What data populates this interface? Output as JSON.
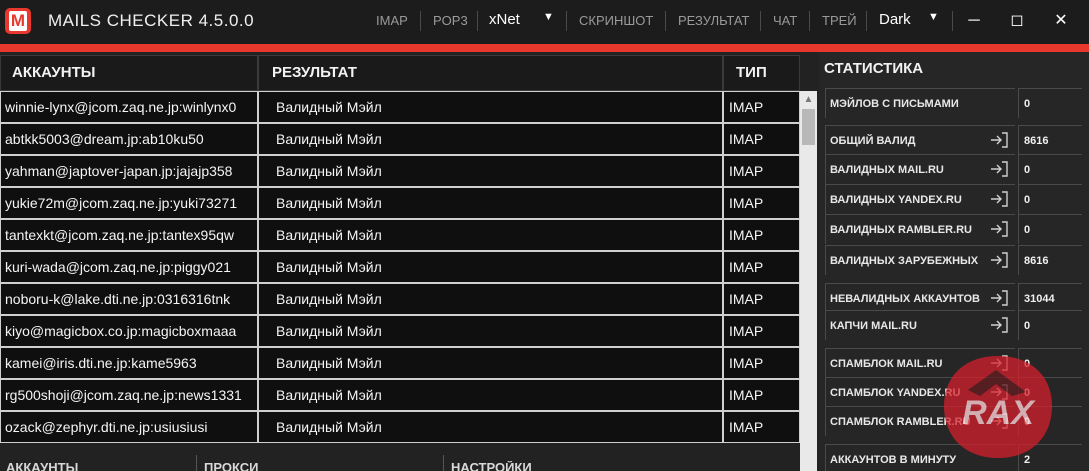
{
  "window": {
    "title": "MAILS CHECKER 4.5.0.0",
    "logo_letter": "M"
  },
  "menu": {
    "imap": "IMAP",
    "pop3": "POP3",
    "proxy_type": "xNet",
    "screenshot": "СКРИНШОТ",
    "result": "РЕЗУЛЬТАТ",
    "chat": "ЧАТ",
    "tray": "ТРЕЙ",
    "theme": "Dark"
  },
  "table": {
    "headers": {
      "accounts": "АККАУНТЫ",
      "result": "РЕЗУЛЬТАТ",
      "type": "ТИП"
    },
    "rows": [
      {
        "account": "winnie-lynx@jcom.zaq.ne.jp:winlynx0",
        "result": "Валидный Мэйл",
        "type": "IMAP"
      },
      {
        "account": "abtkk5003@dream.jp:ab10ku50",
        "result": "Валидный Мэйл",
        "type": "IMAP"
      },
      {
        "account": "yahman@japtover-japan.jp:jajajp358",
        "result": "Валидный Мэйл",
        "type": "IMAP"
      },
      {
        "account": "yukie72m@jcom.zaq.ne.jp:yuki73271",
        "result": "Валидный Мэйл",
        "type": "IMAP"
      },
      {
        "account": "tantexkt@jcom.zaq.ne.jp:tantex95qw",
        "result": "Валидный Мэйл",
        "type": "IMAP"
      },
      {
        "account": "kuri-wada@jcom.zaq.ne.jp:piggy021",
        "result": "Валидный Мэйл",
        "type": "IMAP"
      },
      {
        "account": "noboru-k@lake.dti.ne.jp:0316316tnk",
        "result": "Валидный Мэйл",
        "type": "IMAP"
      },
      {
        "account": "kiyo@magicbox.co.jp:magicboxmaaa",
        "result": "Валидный Мэйл",
        "type": "IMAP"
      },
      {
        "account": "kamei@iris.dti.ne.jp:kame5963",
        "result": "Валидный Мэйл",
        "type": "IMAP"
      },
      {
        "account": "rg500shoji@jcom.zaq.ne.jp:news1331",
        "result": "Валидный Мэйл",
        "type": "IMAP"
      },
      {
        "account": "ozack@zephyr.dti.ne.jp:usiusiusi",
        "result": "Валидный Мэйл",
        "type": "IMAP"
      }
    ]
  },
  "bottom_tabs": {
    "accounts": "АККАУНТЫ",
    "proxy": "ПРОКСИ",
    "settings": "НАСТРОЙКИ"
  },
  "stats": {
    "title": "СТАТИСТИКА",
    "rows": [
      {
        "label": "МЭЙЛОВ С ПИСЬМАМИ",
        "value": "0",
        "export": false
      },
      {
        "label": "ОБЩИЙ ВАЛИД",
        "value": "8616",
        "export": true
      },
      {
        "label": "ВАЛИДНЫХ MAIL.RU",
        "value": "0",
        "export": true
      },
      {
        "label": "ВАЛИДНЫХ YANDEX.RU",
        "value": "0",
        "export": true
      },
      {
        "label": "ВАЛИДНЫХ RAMBLER.RU",
        "value": "0",
        "export": true
      },
      {
        "label": "ВАЛИДНЫХ ЗАРУБЕЖНЫХ",
        "value": "8616",
        "export": true
      },
      {
        "label": "НЕВАЛИДНЫХ АККАУНТОВ",
        "value": "31044",
        "export": true
      },
      {
        "label": "КАПЧИ MAIL.RU",
        "value": "0",
        "export": true
      },
      {
        "label": "СПАМБЛОК MAIL.RU",
        "value": "0",
        "export": true
      },
      {
        "label": "СПАМБЛОК YANDEX.RU",
        "value": "0",
        "export": true
      },
      {
        "label": "СПАМБЛОК RAMBLER.RU",
        "value": "0",
        "export": true
      },
      {
        "label": "АККАУНТОВ В МИНУТУ",
        "value": "2",
        "export": false
      }
    ]
  },
  "colors": {
    "accent": "#e8372c",
    "background": "#1e1e1e"
  }
}
